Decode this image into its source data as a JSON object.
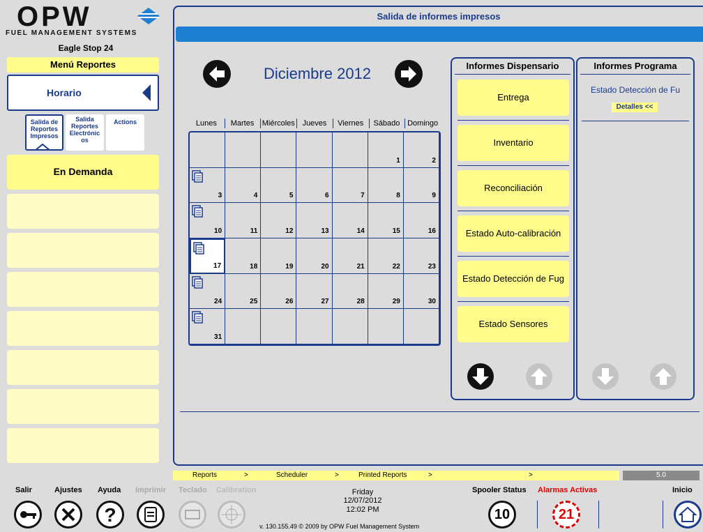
{
  "brand": {
    "logo": "OPW",
    "tagline": "FUEL MANAGEMENT SYSTEMS",
    "site": "Eagle Stop 24"
  },
  "sidebar": {
    "menu_title": "Menú Reportes",
    "selected": "Horario",
    "subtabs": [
      {
        "label": "Salida de Reportes Impresos",
        "active": true
      },
      {
        "label": "Salida Reportes Electrónic os",
        "active": false
      },
      {
        "label": "Actions",
        "active": false
      }
    ],
    "items": [
      "En Demanda",
      "",
      "",
      "",
      "",
      "",
      "",
      ""
    ]
  },
  "page": {
    "title": "Salida de informes impresos"
  },
  "calendar": {
    "month": "Diciembre 2012",
    "weekdays": [
      "Lunes",
      "Martes",
      "Miércoles",
      "Jueves",
      "Viernes",
      "Sábado",
      "Domingo"
    ],
    "weeks": [
      [
        "",
        "",
        "",
        "",
        "",
        "1",
        "2"
      ],
      [
        "3",
        "4",
        "5",
        "6",
        "7",
        "8",
        "9"
      ],
      [
        "10",
        "11",
        "12",
        "13",
        "14",
        "15",
        "16"
      ],
      [
        "17",
        "18",
        "19",
        "20",
        "21",
        "22",
        "23"
      ],
      [
        "24",
        "25",
        "26",
        "27",
        "28",
        "29",
        "30"
      ],
      [
        "31",
        "",
        "",
        "",
        "",
        "",
        ""
      ]
    ],
    "report_days": [
      "3",
      "10",
      "17",
      "24",
      "31"
    ],
    "selected_day": "17"
  },
  "dispenser": {
    "title": "Informes Dispensario",
    "buttons": [
      "Entrega",
      "Inventario",
      "Reconciliación",
      "Estado Auto-calibración",
      "Estado Detección de Fug",
      "Estado Sensores"
    ]
  },
  "program": {
    "title": "Informes Programa",
    "item": "Estado Detección de Fu",
    "details": "Detalles <<"
  },
  "breadcrumb": {
    "items": [
      "Reports",
      ">",
      "Scheduler",
      ">",
      "Printed Reports",
      ">",
      ">"
    ],
    "version": "5.0"
  },
  "footer": {
    "labels": [
      "Salir",
      "Ajustes",
      "Ayuda",
      "Imprimir",
      "Teclado",
      "Calibration"
    ],
    "day": "Friday",
    "date": "12/07/2012",
    "time": "12:02 PM",
    "copyright": "v. 130.155.49   © 2009 by OPW Fuel Management System",
    "spooler_label": "Spooler Status",
    "spooler_count": "10",
    "alarms_label": "Alarmas Activas",
    "alarms_count": "21",
    "home_label": "Inicio"
  },
  "colors": {
    "accent": "#1a3a8c",
    "yellow": "#fffc8c",
    "bar": "#1f7fd0",
    "alarm": "#e00000"
  }
}
